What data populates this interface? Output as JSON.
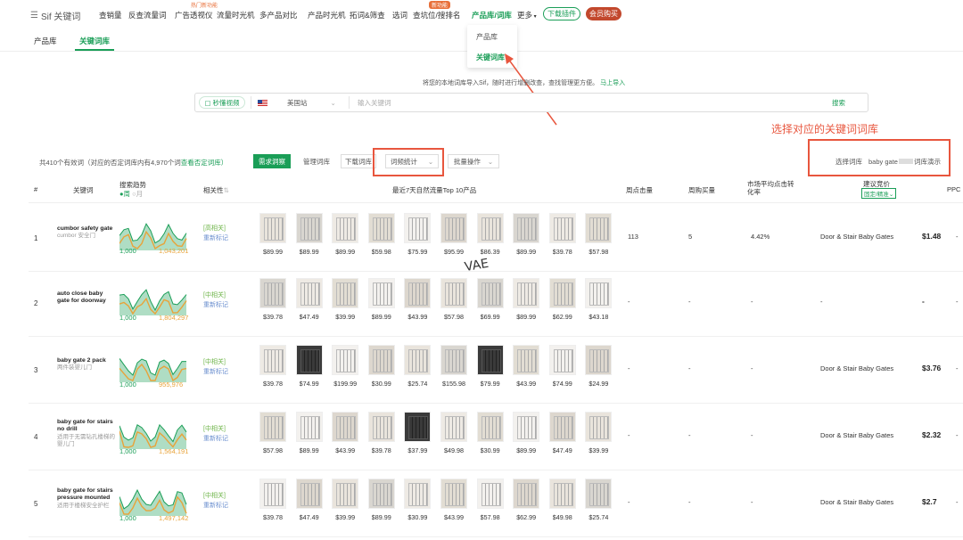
{
  "nav": {
    "logo": "Sif 关键词",
    "items": [
      "查销量",
      "反查流量词",
      "广告透视仪",
      "流量时光机",
      "多产品对比",
      "产品时光机",
      "拓词&筛查",
      "选词",
      "查坑位/搜排名",
      "产品库/词库",
      "更多"
    ],
    "hot_badge_1": "热门新功能",
    "hot_badge_2": "新功能",
    "download": "下载插件",
    "vip": "会员购买"
  },
  "subnav": {
    "tabs": [
      "产品库",
      "关键词库"
    ]
  },
  "dropdown": {
    "items": [
      "产品库",
      "关键词库"
    ]
  },
  "import_hint": {
    "text": "将您的本地词库导入Sif，随时进行增删改查，查找管理更方便。",
    "link": "马上导入"
  },
  "search": {
    "filter": "秒懂视频",
    "site": "美国站",
    "placeholder": "输入关键词",
    "button": "搜索"
  },
  "annotation": "选择对应的关键词词库",
  "toolbar": {
    "summary": "共410个有效词（对应的否定词库内有4,970个词",
    "summary_link": "查看否定词库）",
    "btn_req": "需求洞察",
    "btn_manage": "管理词库",
    "btn_download": "下载词库",
    "btn_stats": "词频统计",
    "btn_batch": "批量操作",
    "select_label": "选择词库",
    "select_value": "baby gate",
    "select_suffix": "词库演示"
  },
  "table": {
    "headers": {
      "idx": "#",
      "keyword": "关键词",
      "trend": "搜索趋势",
      "trend_week": "周",
      "trend_month": "月",
      "relevance": "相关性",
      "top10": "最近7天自然流量Top 10产品",
      "clicks": "周点击量",
      "purchases": "周购买量",
      "cvr": "市场平均点击转化率",
      "bid": "建议竞价",
      "bid_sub": "固定/精准",
      "ppc": "PPC"
    },
    "rows": [
      {
        "idx": "1",
        "kw": "cumbor safety gate",
        "kw_cn": "cumbor 安全门",
        "tr_min": "1,000",
        "tr_max": "1,043,201",
        "rel": "[高相关]",
        "mark": "重新标记",
        "prices": [
          "$89.99",
          "$89.99",
          "$89.99",
          "$59.98",
          "$75.99",
          "$95.99",
          "$86.39",
          "$89.99",
          "$39.78",
          "$57.98"
        ],
        "clicks": "113",
        "purch": "5",
        "cvr": "4.42%",
        "cat": "Door & Stair Baby Gates",
        "bid": "$1.48",
        "ppc": "-"
      },
      {
        "idx": "2",
        "kw": "auto close baby gate for doorway",
        "kw_cn": "",
        "tr_min": "1,000",
        "tr_max": "1,804,297",
        "rel": "[中相关]",
        "mark": "重新标记",
        "prices": [
          "$39.78",
          "$47.49",
          "$39.99",
          "$89.99",
          "$43.99",
          "$57.98",
          "$69.99",
          "$89.99",
          "$62.99",
          "$43.18"
        ],
        "clicks": "-",
        "purch": "-",
        "cvr": "-",
        "cat": "-",
        "bid": "-",
        "ppc": "-"
      },
      {
        "idx": "3",
        "kw": "baby gate 2 pack",
        "kw_cn": "两件装婴儿门",
        "tr_min": "1,000",
        "tr_max": "955,976",
        "rel": "[中相关]",
        "mark": "重新标记",
        "prices": [
          "$39.78",
          "$74.99",
          "$199.99",
          "$30.99",
          "$25.74",
          "$155.98",
          "$79.99",
          "$43.99",
          "$74.99",
          "$24.99"
        ],
        "clicks": "-",
        "purch": "-",
        "cvr": "-",
        "cat": "Door & Stair Baby Gates",
        "bid": "$3.76",
        "ppc": "-"
      },
      {
        "idx": "4",
        "kw": "baby gate for stairs no drill",
        "kw_cn": "适用于无需钻孔楼梯的婴儿门",
        "tr_min": "1,000",
        "tr_max": "1,564,191",
        "rel": "[中相关]",
        "mark": "重新标记",
        "prices": [
          "$57.98",
          "$89.99",
          "$43.99",
          "$39.78",
          "$37.99",
          "$49.98",
          "$30.99",
          "$89.99",
          "$47.49",
          "$39.99"
        ],
        "clicks": "-",
        "purch": "-",
        "cvr": "-",
        "cat": "Door & Stair Baby Gates",
        "bid": "$2.32",
        "ppc": "-"
      },
      {
        "idx": "5",
        "kw": "baby gate for stairs pressure mounted",
        "kw_cn": "适用于楼梯安全护栏",
        "tr_min": "1,000",
        "tr_max": "1,497,142",
        "rel": "[中相关]",
        "mark": "重新标记",
        "prices": [
          "$39.78",
          "$47.49",
          "$39.99",
          "$89.99",
          "$30.99",
          "$43.99",
          "$57.98",
          "$62.99",
          "$49.98",
          "$25.74"
        ],
        "clicks": "-",
        "purch": "-",
        "cvr": "-",
        "cat": "Door & Stair Baby Gates",
        "bid": "$2.7",
        "ppc": "-"
      }
    ]
  },
  "watermark": "VAE",
  "colors": {
    "accent": "#1a9e57",
    "annotation": "#e8563e",
    "vip": "#c2482d",
    "trend_orange": "#e8a33a"
  }
}
